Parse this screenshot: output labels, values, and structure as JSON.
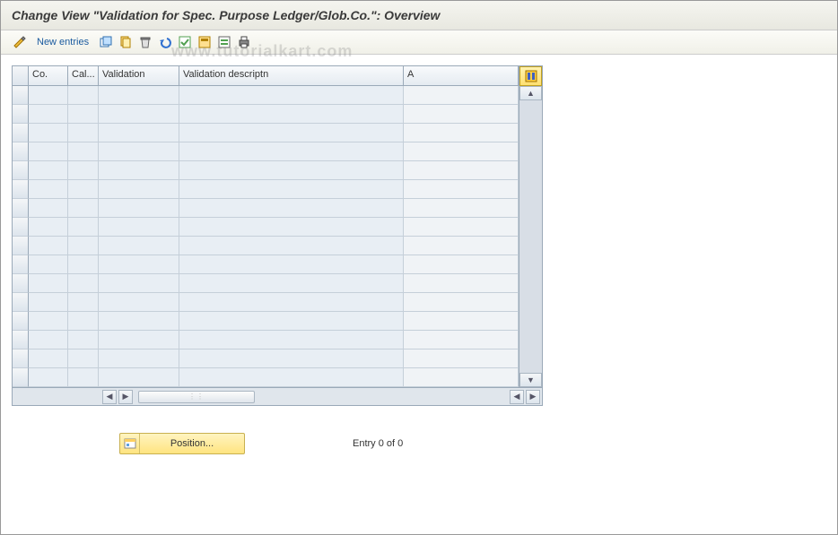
{
  "title": "Change View \"Validation for Spec. Purpose Ledger/Glob.Co.\": Overview",
  "toolbar": {
    "new_entries": "New entries"
  },
  "watermark": "www.tutorialkart.com",
  "table": {
    "columns": {
      "co": "Co.",
      "cal": "Cal...",
      "validation": "Validation",
      "descriptn": "Validation descriptn",
      "a": "A"
    },
    "row_count": 16
  },
  "footer": {
    "position_label": "Position...",
    "entry_text": "Entry 0 of 0"
  }
}
